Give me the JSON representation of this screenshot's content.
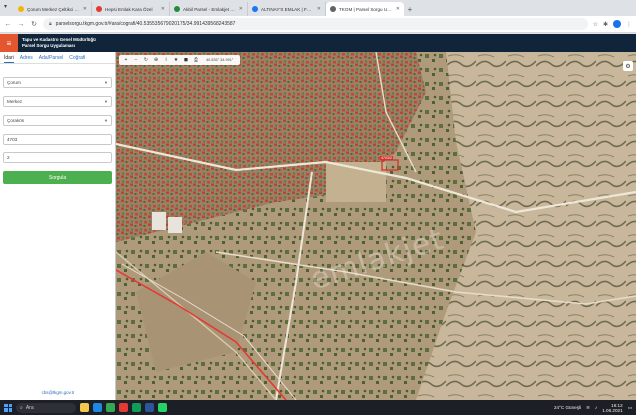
{
  "browser": {
    "tabs": [
      {
        "title": "Çorum Merkez Çeltikci Toki Arsa",
        "color": "#f2b705",
        "active": false
      },
      {
        "title": "Hepsi Emlak Kara Özel",
        "color": "#e53935",
        "active": false
      },
      {
        "title": "Akbil Parsel - Emlakjet Panel",
        "color": "#1e8e3e",
        "active": false
      },
      {
        "title": "ALTINAY'S EMLAK | Facebook",
        "color": "#1877f2",
        "active": false
      },
      {
        "title": "TKGM | Parsel Sorgu Uygulaması",
        "color": "#5f6368",
        "active": true
      }
    ],
    "new_tab": "+",
    "url": "parselsorgu.tkgm.gov.tr/#ara/cografi/40.535535679020175/34.991439568243587"
  },
  "app": {
    "header_line1": "Tapu ve Kadastro Genel Müdürlüğü",
    "header_line2": "Parsel Sorgu Uygulaması",
    "menu_icon": "menu-icon"
  },
  "panel": {
    "tabs": [
      "İdari",
      "Adres",
      "Ada/Parsel",
      "Coğrafi"
    ],
    "fields": {
      "il": "Çorum",
      "ilce": "Merkez",
      "mahalle": "Çorakös",
      "ada": "4703",
      "parsel": "2"
    },
    "query_button": "Sorgula",
    "email": "cbs@tkgm.gov.tr"
  },
  "map": {
    "toolbar": [
      "+",
      "−",
      "↻",
      "⊕",
      "i",
      "★",
      "◼",
      "⎙"
    ],
    "coords": "40.535°  34.991°",
    "parcel_label": "4703/2",
    "watermark": "emlakjet",
    "colors": {
      "parcel": "#d2342b",
      "road": "#ffffff",
      "railway": "#e53935"
    }
  },
  "taskbar": {
    "search": "Ara",
    "weather": "24°C  Güneşli",
    "time": "16:12",
    "date": "1.06.2021"
  }
}
